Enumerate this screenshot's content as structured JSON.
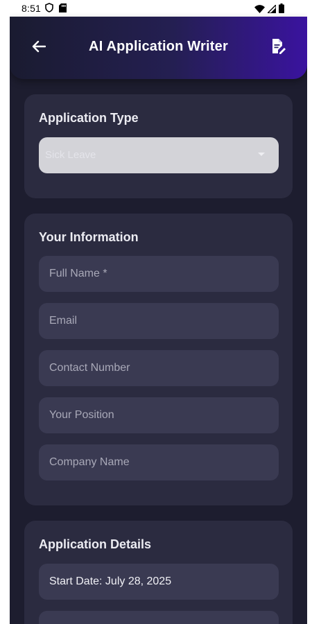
{
  "status_bar": {
    "time": "8:51",
    "icons": [
      "shield-icon",
      "sd-card-icon",
      "wifi-icon",
      "signal-icon",
      "battery-icon"
    ]
  },
  "app_bar": {
    "title": "AI Application Writer",
    "back_icon": "arrow-left-icon",
    "action_icon": "document-edit-icon",
    "gradient_colors": [
      "#1a1b30",
      "#3a139f"
    ]
  },
  "application_type": {
    "title": "Application Type",
    "selected": "Sick Leave"
  },
  "your_information": {
    "title": "Your Information",
    "fields": {
      "full_name": "Full Name *",
      "email": "Email",
      "contact_number": "Contact Number",
      "position": "Your Position",
      "company_name": "Company Name"
    }
  },
  "application_details": {
    "title": "Application Details",
    "start_date": "Start Date: July 28, 2025"
  },
  "colors": {
    "background": "#1d1d2f",
    "card": "#2b2b40",
    "field": "#3a3a52",
    "accent": "#3a139f"
  }
}
